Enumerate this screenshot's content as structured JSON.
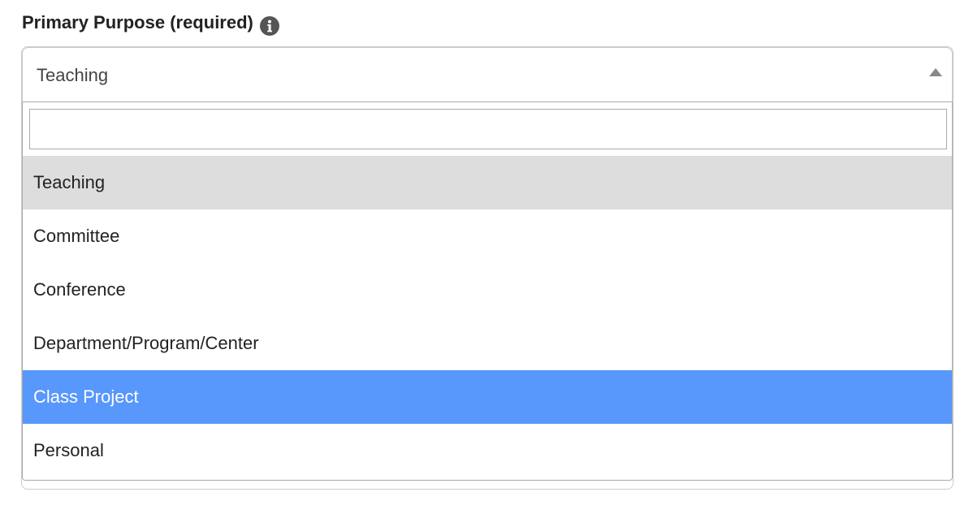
{
  "field": {
    "label": "Primary Purpose (required)",
    "info_icon": "info-circle-icon"
  },
  "select": {
    "selected_value": "Teaching",
    "arrow_icon": "caret-up-icon",
    "search": {
      "value": "",
      "placeholder": ""
    },
    "options": [
      {
        "label": "Teaching",
        "state": "selected"
      },
      {
        "label": "Committee",
        "state": "normal"
      },
      {
        "label": "Conference",
        "state": "normal"
      },
      {
        "label": "Department/Program/Center",
        "state": "normal"
      },
      {
        "label": "Class Project",
        "state": "highlighted"
      },
      {
        "label": "Personal",
        "state": "normal"
      }
    ]
  },
  "colors": {
    "selected_bg": "#dddddd",
    "highlight_bg": "#5897fb",
    "highlight_text": "#ffffff",
    "text": "#222222",
    "border": "#aaaaaa",
    "icon": "#555555"
  }
}
